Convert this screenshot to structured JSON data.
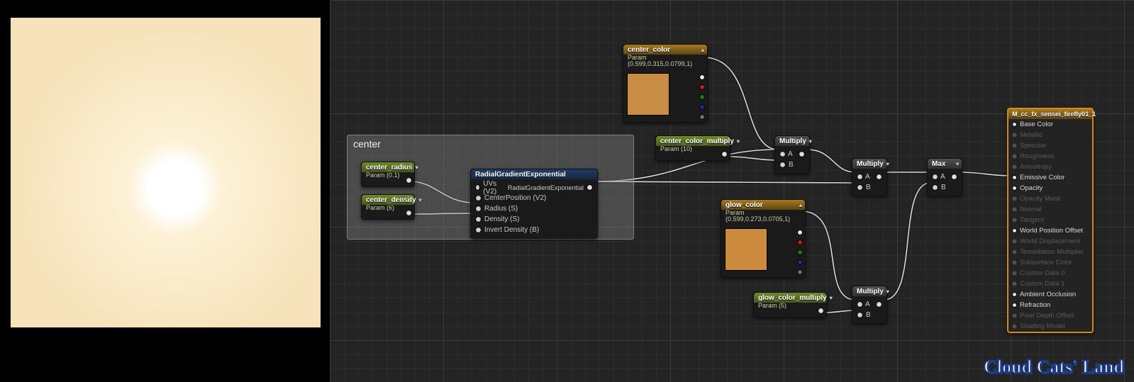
{
  "comment": {
    "title": "center"
  },
  "center_radius": {
    "title": "center_radius",
    "param": "Param (0.1)"
  },
  "center_density": {
    "title": "center_density",
    "param": "Param (6)"
  },
  "rge": {
    "title": "RadialGradientExponential",
    "pins": {
      "uvs": "UVs (V2)",
      "cp": "CenterPosition (V2)",
      "rad": "Radius (S)",
      "den": "Density (S)",
      "inv": "Invert Density (B)"
    },
    "out": "RadialGradientExponential"
  },
  "center_color": {
    "title": "center_color",
    "param": "Param (0.599,0.315,0.0799,1)",
    "swatch": "#c88c44"
  },
  "center_color_multiply": {
    "title": "center_color_multiply",
    "param": "Param (10)"
  },
  "glow_color": {
    "title": "glow_color",
    "param": "Param (0.599,0.273,0.0705,1)",
    "swatch": "#cb8a3e"
  },
  "glow_color_multiply": {
    "title": "glow_color_multiply",
    "param": "Param (5)"
  },
  "multiply_label": "Multiply",
  "ab_a": "A",
  "ab_b": "B",
  "max_label": "Max",
  "material": {
    "title": "M_cc_fx_sensei_firefly01_1",
    "pins": [
      {
        "label": "Base Color",
        "on": true
      },
      {
        "label": "Metallic",
        "on": false
      },
      {
        "label": "Specular",
        "on": false
      },
      {
        "label": "Roughness",
        "on": false
      },
      {
        "label": "Anisotropy",
        "on": false
      },
      {
        "label": "Emissive Color",
        "on": true
      },
      {
        "label": "Opacity",
        "on": true
      },
      {
        "label": "Opacity Mask",
        "on": false
      },
      {
        "label": "Normal",
        "on": false
      },
      {
        "label": "Tangent",
        "on": false
      },
      {
        "label": "World Position Offset",
        "on": true
      },
      {
        "label": "World Displacement",
        "on": false
      },
      {
        "label": "Tessellation Multiplier",
        "on": false
      },
      {
        "label": "Subsurface Color",
        "on": false
      },
      {
        "label": "Custom Data 0",
        "on": false
      },
      {
        "label": "Custom Data 1",
        "on": false
      },
      {
        "label": "Ambient Occlusion",
        "on": true
      },
      {
        "label": "Refraction",
        "on": true
      },
      {
        "label": "Pixel Depth Offset",
        "on": false
      },
      {
        "label": "Shading Model",
        "on": false
      }
    ]
  },
  "watermark": "Cloud Cats' Land"
}
